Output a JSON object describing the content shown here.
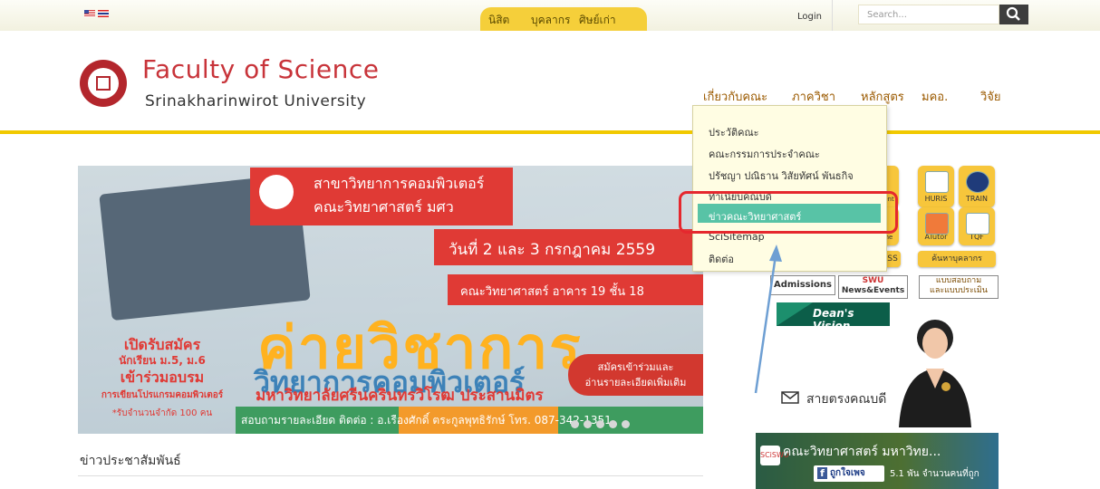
{
  "topbar": {
    "roles": [
      "นิสิต",
      "บุคลากร",
      "ศิษย์เก่า"
    ],
    "login": "Login",
    "search_placeholder": "Search..."
  },
  "brand": {
    "title": "Faculty of Science",
    "subtitle": "Srinakharinwirot University"
  },
  "nav": [
    "เกี่ยวกับคณะ",
    "ภาควิชา",
    "หลักสูตร",
    "มคอ.",
    "วิจัย"
  ],
  "dropdown": {
    "items": [
      "ประวัติคณะ",
      "คณะกรรมการประจำคณะ",
      "ปรัชญา ปณิธาน วิสัยทัศน์ พันธกิจ",
      "ทำเนียบคณบดี",
      "ข่าวคณะวิทยาศาสตร์",
      "SciSitemap",
      "ติดต่อ"
    ],
    "active_index": 4
  },
  "banner": {
    "dept": "สาขาวิทยาการคอมพิวเตอร์",
    "faculty": "คณะวิทยาศาสตร์ มศว",
    "date": "วันที่ 2 และ 3 กรกฎาคม 2559",
    "place": "คณะวิทยาศาสตร์ อาคาร 19 ชั้น 18",
    "camp": "ค่ายวิชาการ",
    "subject": "วิทยาการคอมพิวเตอร์",
    "university": "มหาวิทยาลัยศรีนครินทรวิโรฒ ประสานมิตร",
    "left": [
      "เปิดรับสมัคร",
      "นักเรียน ม.5, ม.6",
      "เข้าร่วมอบรม",
      "การเขียนโปรแกรมคอมพิวเตอร์",
      "*รับจำนวนจำกัด 100 คน"
    ],
    "apply1": "สมัครเข้าร่วมและ",
    "apply2": "อ่านรายละเอียดเพิ่มเติม",
    "contact": "สอบถามรายละเอียด ติดต่อ : อ.เรืองศักดิ์ ตระกูลพุทธิรักษ์ โทร. 087-342-1351",
    "slides": 5
  },
  "news": {
    "title": "ข่าวประชาสัมพันธ์"
  },
  "side": {
    "tiles": [
      {
        "label": "HURIS"
      },
      {
        "label": "TRAIN"
      },
      {
        "label": "ATutor"
      },
      {
        "label": "TQF"
      }
    ],
    "partial_labels": [
      "ent",
      "ne",
      "ASS"
    ],
    "staff_search": "ค้นหาบุคลากร",
    "admissions": "Admissions",
    "swu_news": "News&Events",
    "swu_logo": "SWU",
    "survey1": "แบบสอบถาม",
    "survey2": "และแบบประเมิน",
    "dean": "Dean's Vision",
    "mail": "สายตรงคณบดี",
    "fb_title": "คณะวิทยาศาสตร์ มหาวิทย...",
    "fb_like": "ถูกใจเพจ",
    "fb_count": "5.1 พัน จำนวนคนที่ถูก",
    "fb_logo": "SCiSWU"
  },
  "colors": {
    "brand_red": "#c8343a",
    "accent_yellow": "#f1c900",
    "active_green": "#58c3a6",
    "highlight": "#e5282e"
  }
}
